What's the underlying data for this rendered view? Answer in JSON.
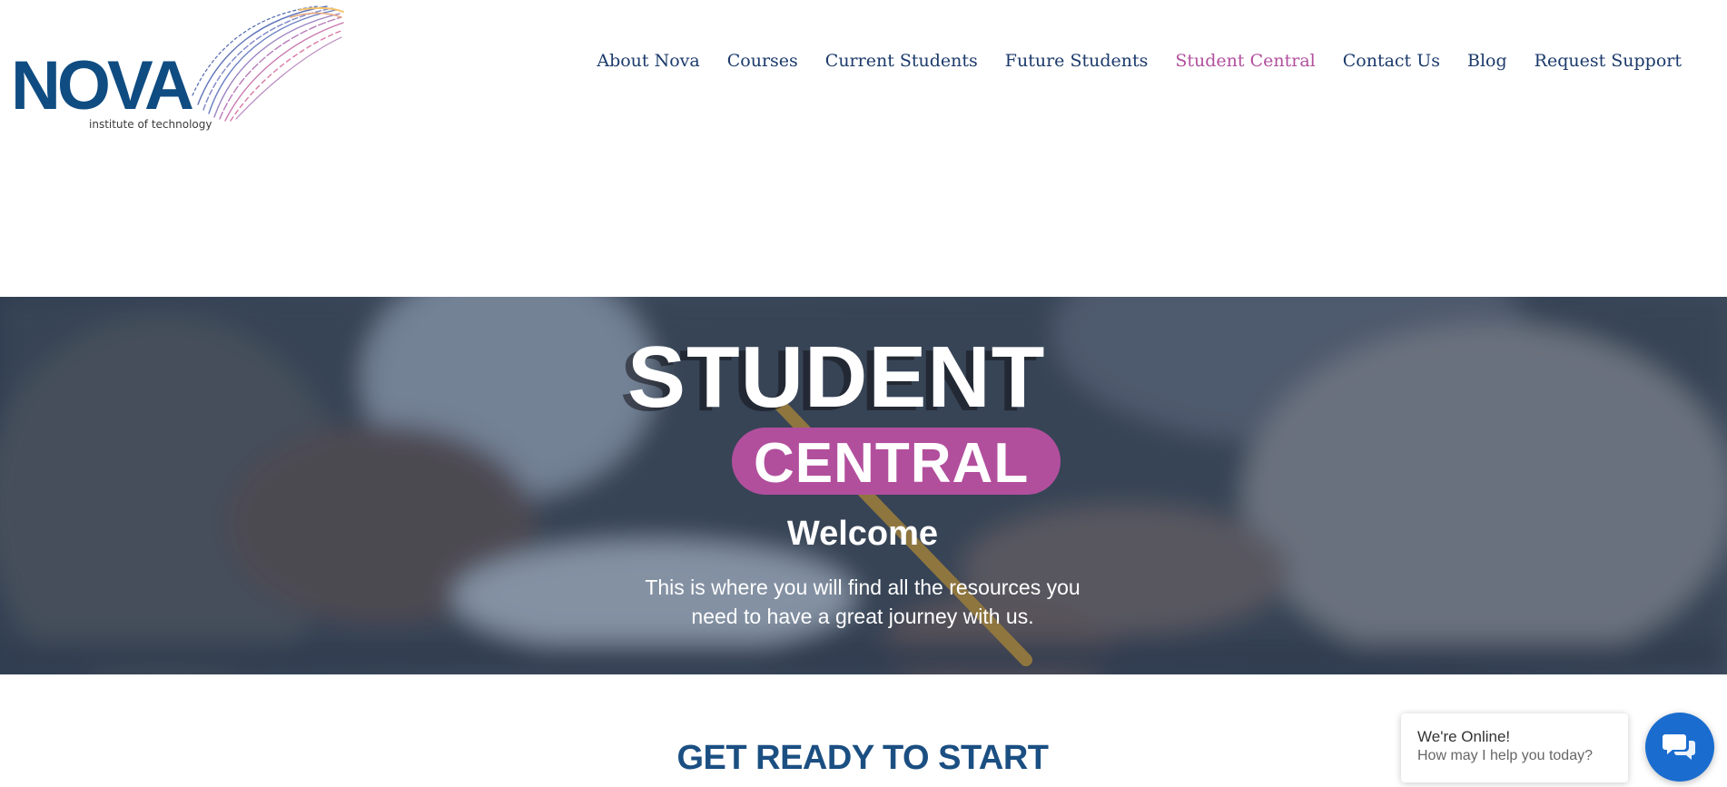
{
  "logo": {
    "wordmark": "NOVA",
    "subtitle": "institute of technology"
  },
  "nav": {
    "items": [
      {
        "label": "About Nova",
        "active": false
      },
      {
        "label": "Courses",
        "active": false
      },
      {
        "label": "Current Students",
        "active": false
      },
      {
        "label": "Future Students",
        "active": false
      },
      {
        "label": "Student Central",
        "active": true
      },
      {
        "label": "Contact Us",
        "active": false
      },
      {
        "label": "Blog",
        "active": false
      },
      {
        "label": "Request Support",
        "active": false
      }
    ]
  },
  "hero": {
    "title": "STUDENT",
    "pill": "CENTRAL",
    "welcome": "Welcome",
    "description": "This is where you will find all the resources you need to have a great journey with us."
  },
  "section": {
    "title": "GET READY TO START"
  },
  "chat": {
    "status": "We're Online!",
    "prompt": "How may I help you today?",
    "icon": "chat-bubbles-icon"
  },
  "colors": {
    "brand_navy": "#0f4c81",
    "nav_text": "#1b3a6b",
    "accent_magenta": "#b24f9d",
    "chat_blue": "#1a6dcf"
  }
}
